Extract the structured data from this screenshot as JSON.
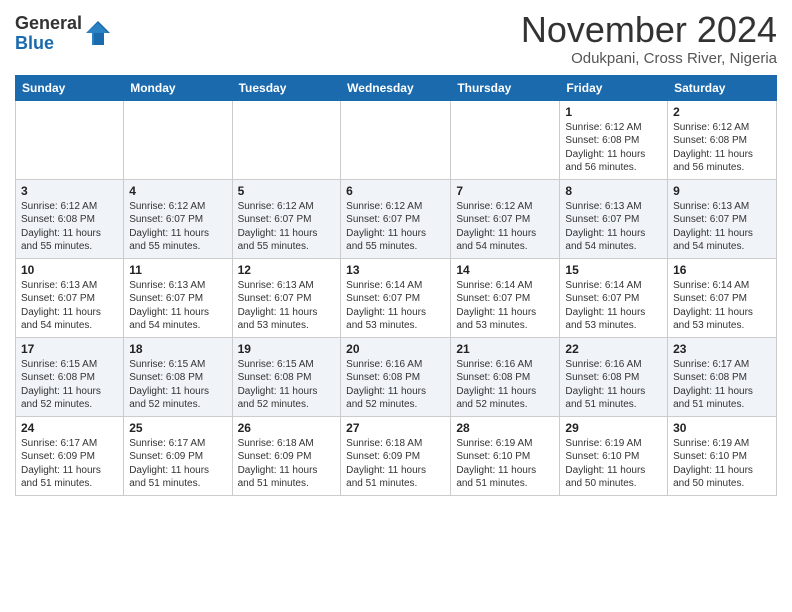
{
  "logo": {
    "general": "General",
    "blue": "Blue"
  },
  "header": {
    "month": "November 2024",
    "location": "Odukpani, Cross River, Nigeria"
  },
  "weekdays": [
    "Sunday",
    "Monday",
    "Tuesday",
    "Wednesday",
    "Thursday",
    "Friday",
    "Saturday"
  ],
  "weeks": [
    [
      {
        "day": "",
        "info": ""
      },
      {
        "day": "",
        "info": ""
      },
      {
        "day": "",
        "info": ""
      },
      {
        "day": "",
        "info": ""
      },
      {
        "day": "",
        "info": ""
      },
      {
        "day": "1",
        "info": "Sunrise: 6:12 AM\nSunset: 6:08 PM\nDaylight: 11 hours and 56 minutes."
      },
      {
        "day": "2",
        "info": "Sunrise: 6:12 AM\nSunset: 6:08 PM\nDaylight: 11 hours and 56 minutes."
      }
    ],
    [
      {
        "day": "3",
        "info": "Sunrise: 6:12 AM\nSunset: 6:08 PM\nDaylight: 11 hours and 55 minutes."
      },
      {
        "day": "4",
        "info": "Sunrise: 6:12 AM\nSunset: 6:07 PM\nDaylight: 11 hours and 55 minutes."
      },
      {
        "day": "5",
        "info": "Sunrise: 6:12 AM\nSunset: 6:07 PM\nDaylight: 11 hours and 55 minutes."
      },
      {
        "day": "6",
        "info": "Sunrise: 6:12 AM\nSunset: 6:07 PM\nDaylight: 11 hours and 55 minutes."
      },
      {
        "day": "7",
        "info": "Sunrise: 6:12 AM\nSunset: 6:07 PM\nDaylight: 11 hours and 54 minutes."
      },
      {
        "day": "8",
        "info": "Sunrise: 6:13 AM\nSunset: 6:07 PM\nDaylight: 11 hours and 54 minutes."
      },
      {
        "day": "9",
        "info": "Sunrise: 6:13 AM\nSunset: 6:07 PM\nDaylight: 11 hours and 54 minutes."
      }
    ],
    [
      {
        "day": "10",
        "info": "Sunrise: 6:13 AM\nSunset: 6:07 PM\nDaylight: 11 hours and 54 minutes."
      },
      {
        "day": "11",
        "info": "Sunrise: 6:13 AM\nSunset: 6:07 PM\nDaylight: 11 hours and 54 minutes."
      },
      {
        "day": "12",
        "info": "Sunrise: 6:13 AM\nSunset: 6:07 PM\nDaylight: 11 hours and 53 minutes."
      },
      {
        "day": "13",
        "info": "Sunrise: 6:14 AM\nSunset: 6:07 PM\nDaylight: 11 hours and 53 minutes."
      },
      {
        "day": "14",
        "info": "Sunrise: 6:14 AM\nSunset: 6:07 PM\nDaylight: 11 hours and 53 minutes."
      },
      {
        "day": "15",
        "info": "Sunrise: 6:14 AM\nSunset: 6:07 PM\nDaylight: 11 hours and 53 minutes."
      },
      {
        "day": "16",
        "info": "Sunrise: 6:14 AM\nSunset: 6:07 PM\nDaylight: 11 hours and 53 minutes."
      }
    ],
    [
      {
        "day": "17",
        "info": "Sunrise: 6:15 AM\nSunset: 6:08 PM\nDaylight: 11 hours and 52 minutes."
      },
      {
        "day": "18",
        "info": "Sunrise: 6:15 AM\nSunset: 6:08 PM\nDaylight: 11 hours and 52 minutes."
      },
      {
        "day": "19",
        "info": "Sunrise: 6:15 AM\nSunset: 6:08 PM\nDaylight: 11 hours and 52 minutes."
      },
      {
        "day": "20",
        "info": "Sunrise: 6:16 AM\nSunset: 6:08 PM\nDaylight: 11 hours and 52 minutes."
      },
      {
        "day": "21",
        "info": "Sunrise: 6:16 AM\nSunset: 6:08 PM\nDaylight: 11 hours and 52 minutes."
      },
      {
        "day": "22",
        "info": "Sunrise: 6:16 AM\nSunset: 6:08 PM\nDaylight: 11 hours and 51 minutes."
      },
      {
        "day": "23",
        "info": "Sunrise: 6:17 AM\nSunset: 6:08 PM\nDaylight: 11 hours and 51 minutes."
      }
    ],
    [
      {
        "day": "24",
        "info": "Sunrise: 6:17 AM\nSunset: 6:09 PM\nDaylight: 11 hours and 51 minutes."
      },
      {
        "day": "25",
        "info": "Sunrise: 6:17 AM\nSunset: 6:09 PM\nDaylight: 11 hours and 51 minutes."
      },
      {
        "day": "26",
        "info": "Sunrise: 6:18 AM\nSunset: 6:09 PM\nDaylight: 11 hours and 51 minutes."
      },
      {
        "day": "27",
        "info": "Sunrise: 6:18 AM\nSunset: 6:09 PM\nDaylight: 11 hours and 51 minutes."
      },
      {
        "day": "28",
        "info": "Sunrise: 6:19 AM\nSunset: 6:10 PM\nDaylight: 11 hours and 51 minutes."
      },
      {
        "day": "29",
        "info": "Sunrise: 6:19 AM\nSunset: 6:10 PM\nDaylight: 11 hours and 50 minutes."
      },
      {
        "day": "30",
        "info": "Sunrise: 6:19 AM\nSunset: 6:10 PM\nDaylight: 11 hours and 50 minutes."
      }
    ]
  ]
}
